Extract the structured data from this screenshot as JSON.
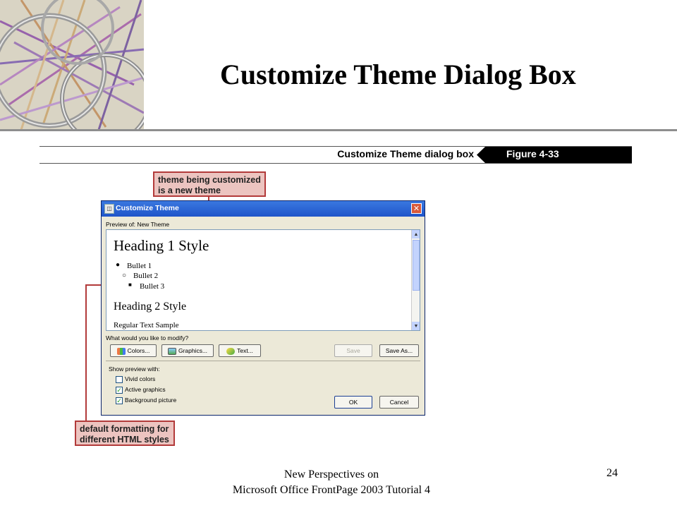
{
  "slide": {
    "title": "Customize Theme Dialog Box",
    "footer_line1": "New Perspectives on",
    "footer_line2": "Microsoft Office FrontPage 2003 Tutorial 4",
    "page_number": "24"
  },
  "figure": {
    "caption": "Customize Theme dialog box",
    "label": "Figure 4-33"
  },
  "callouts": {
    "top_line1": "theme being customized",
    "top_line2": "is a new theme",
    "bottom_line1": "default formatting for",
    "bottom_line2": "different HTML styles"
  },
  "dialog": {
    "title": "Customize Theme",
    "close_glyph": "✕",
    "preview_label": "Preview of: New Theme",
    "preview": {
      "heading1": "Heading 1 Style",
      "bullet1": "Bullet 1",
      "bullet2": "Bullet 2",
      "bullet3": "Bullet 3",
      "heading2": "Heading 2 Style",
      "regular_text": "Regular Text Sample"
    },
    "modify_label": "What would you like to modify?",
    "buttons": {
      "colors": "Colors...",
      "graphics": "Graphics...",
      "text": "Text...",
      "save": "Save",
      "save_as": "Save As...",
      "ok": "OK",
      "cancel": "Cancel"
    },
    "show_preview_label": "Show preview with:",
    "options": [
      {
        "label": "Vivid colors",
        "checked": false
      },
      {
        "label": "Active graphics",
        "checked": true
      },
      {
        "label": "Background picture",
        "checked": true
      }
    ]
  },
  "colors": {
    "callout_fill": "#ecc4c0",
    "callout_border": "#b23a3a",
    "titlebar": "#1f54c9",
    "dialog_bg": "#ece9d8"
  }
}
